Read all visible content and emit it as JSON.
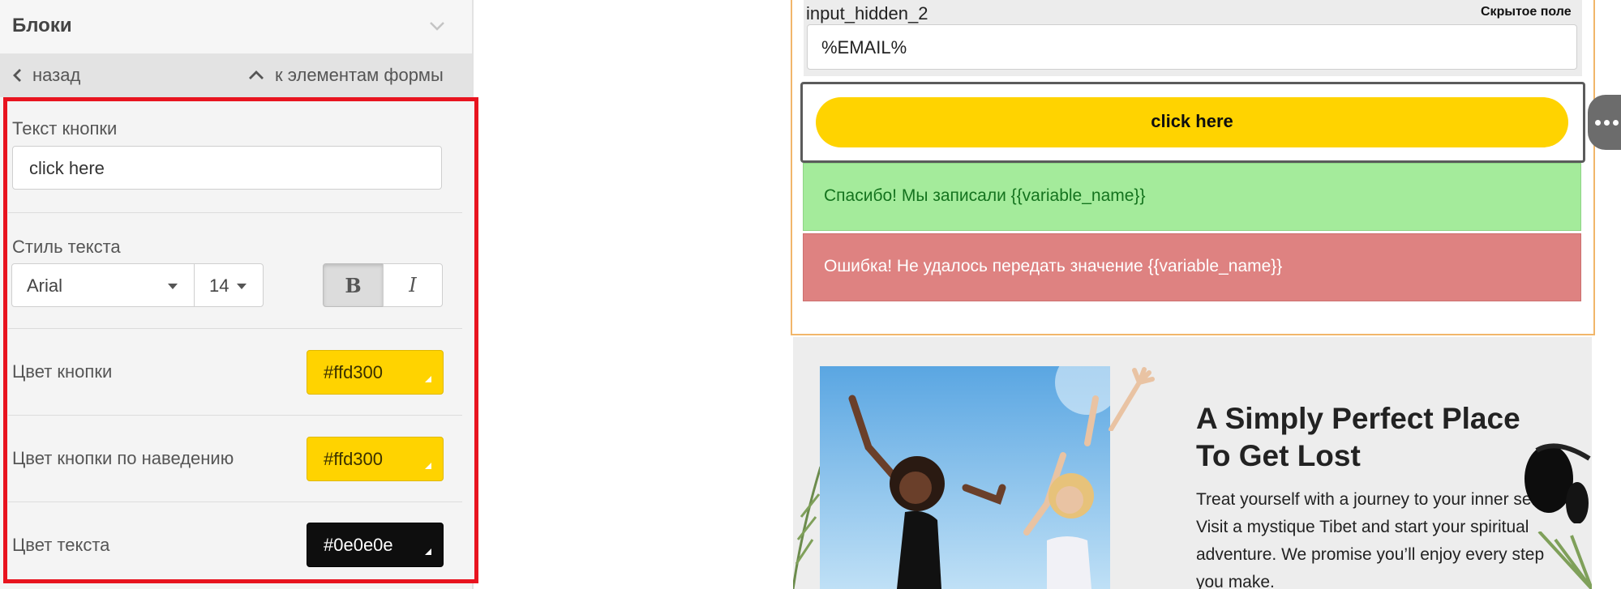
{
  "panel": {
    "title": "Блоки",
    "nav": {
      "back": "назад",
      "up": "к элементам формы"
    }
  },
  "button_settings": {
    "text_label": "Текст кнопки",
    "text_value": "click here",
    "style_label": "Стиль текста",
    "font": "Arial",
    "size": "14",
    "bold": "B",
    "italic": "I",
    "bold_active": true,
    "colors": [
      {
        "label": "Цвет кнопки",
        "value": "#ffd300"
      },
      {
        "label": "Цвет кнопки по наведению",
        "value": "#ffd300"
      },
      {
        "label": "Цвет текста",
        "value": "#0e0e0e"
      }
    ]
  },
  "form": {
    "hidden_field": {
      "name": "input_hidden_2",
      "badge": "Скрытое поле",
      "value": "%EMAIL%"
    },
    "button": {
      "label": "click here",
      "bg": "#ffd300",
      "text_color": "#0e0e0e"
    },
    "success": "Спасибо! Мы записали {{variable_name}}",
    "error": "Ошибка! Не удалось передать значение {{variable_name}}"
  },
  "hero": {
    "title": "A Simply Perfect Place To Get Lost",
    "text": "Treat yourself with a journey to your inner self. Visit a mystique Tibet and start your spiritual adventure. We promise you’ll enjoy every step you make."
  },
  "icons": {
    "collapse": "chevron-down-icon",
    "back": "chevron-left-icon",
    "up": "chevron-up-icon",
    "more": "more-dots-icon"
  }
}
